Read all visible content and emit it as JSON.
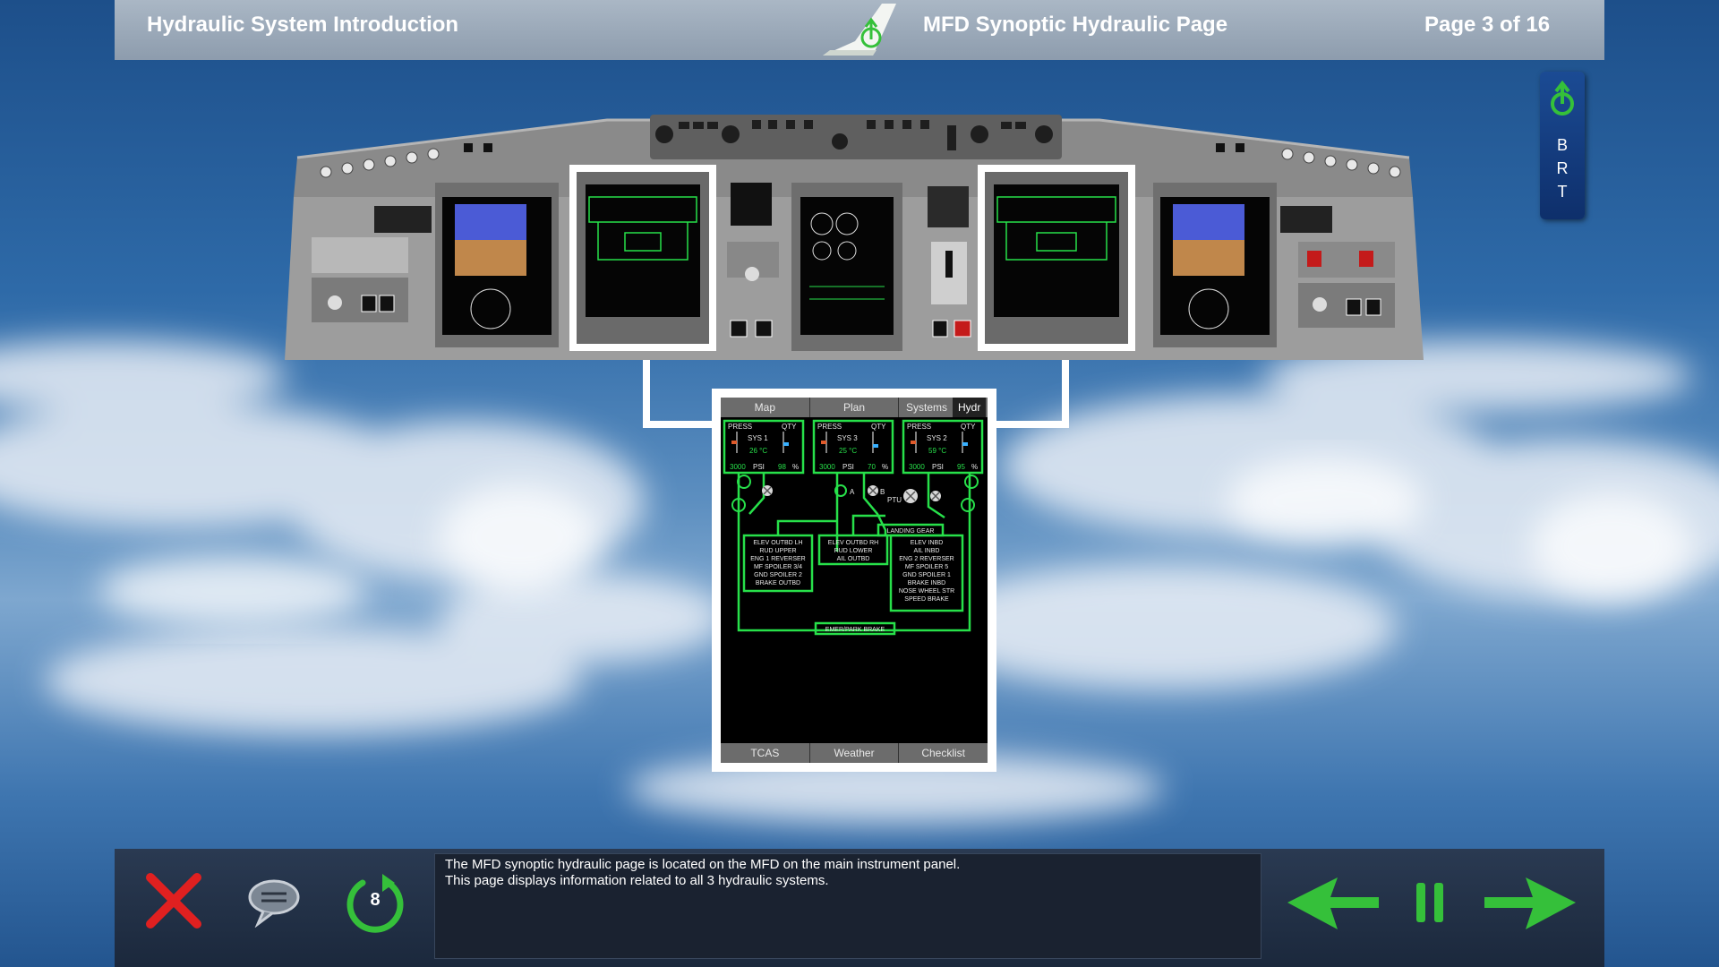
{
  "header": {
    "module_title": "Hydraulic System Introduction",
    "page_title": "MFD Synoptic Hydraulic Page",
    "page_counter": "Page 3 of 16"
  },
  "side_button": {
    "letters": [
      "B",
      "R",
      "T"
    ]
  },
  "mfd": {
    "top_tabs": [
      "Map",
      "Plan",
      "Systems",
      "Hydr"
    ],
    "bottom_tabs": [
      "TCAS",
      "Weather",
      "Checklist"
    ],
    "systems": [
      {
        "label": "SYS 1",
        "press": "PRESS",
        "qty": "QTY",
        "temp": "26 °C",
        "psi": "3000",
        "psi_unit": "PSI",
        "qty_pct": "98",
        "pct_unit": "%"
      },
      {
        "label": "SYS 3",
        "press": "PRESS",
        "qty": "QTY",
        "temp": "25 °C",
        "psi": "3000",
        "psi_unit": "PSI",
        "qty_pct": "70",
        "pct_unit": "%"
      },
      {
        "label": "SYS 2",
        "press": "PRESS",
        "qty": "QTY",
        "temp": "59 °C",
        "psi": "3000",
        "psi_unit": "PSI",
        "qty_pct": "95",
        "pct_unit": "%"
      }
    ],
    "valve_labels": {
      "a": "A",
      "b": "B",
      "ptu": "PTU"
    },
    "landing_gear": "LANDING GEAR",
    "emer_brake": "EMER/PARK BRAKE",
    "box_left": [
      "ELEV OUTBD LH",
      "RUD UPPER",
      "ENG 1 REVERSER",
      "MF SPOILER 3/4",
      "GND SPOILER 2",
      "BRAKE OUTBD"
    ],
    "box_mid": [
      "ELEV OUTBD RH",
      "RUD LOWER",
      "AIL OUTBD"
    ],
    "box_right": [
      "ELEV INBD",
      "AIL INBD",
      "ENG 2 REVERSER",
      "MF SPOILER 5",
      "GND SPOILER 1",
      "BRAKE INBD",
      "NOSE WHEEL STR",
      "SPEED BRAKE"
    ]
  },
  "controls": {
    "replay_count": "8"
  },
  "caption": {
    "line1": "The MFD synoptic hydraulic page is located on the MFD on the main instrument panel.",
    "line2": "This page displays information related to all 3 hydraulic systems."
  },
  "colors": {
    "accent_green": "#35c03a",
    "synoptic_green": "#27e04a",
    "close_red": "#e02020"
  }
}
